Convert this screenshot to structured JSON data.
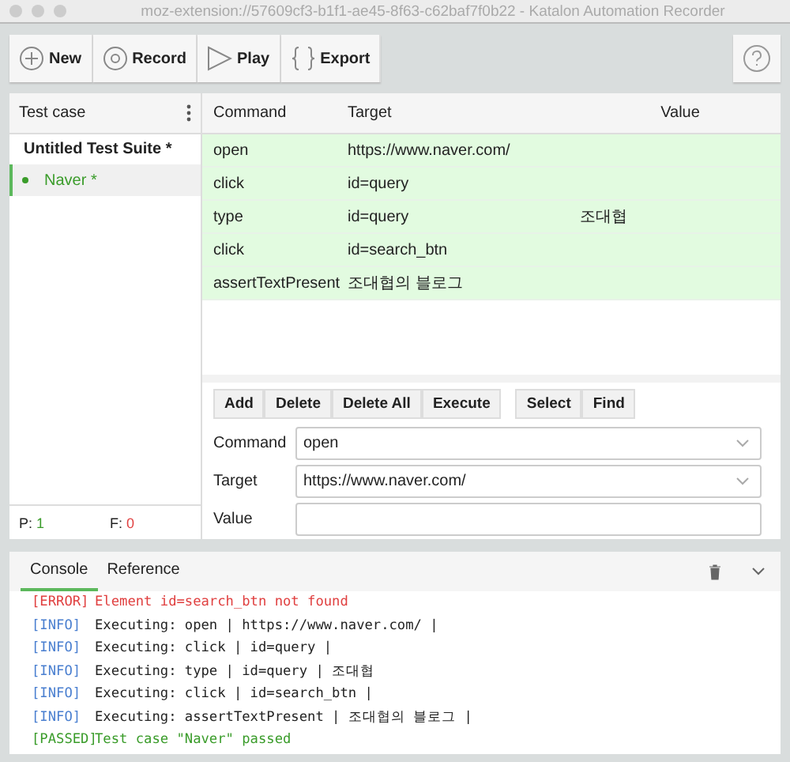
{
  "window": {
    "title": "moz-extension://57609cf3-b1f1-ae45-8f63-c62baf7f0b22 - Katalon Automation Recorder"
  },
  "toolbar": {
    "buttons": [
      {
        "kind": "new",
        "label": "New"
      },
      {
        "kind": "record",
        "label": "Record"
      },
      {
        "kind": "play",
        "label": "Play"
      },
      {
        "kind": "export",
        "label": "Export"
      }
    ]
  },
  "test_panel": {
    "header": "Test case",
    "suites": [
      {
        "name": "Untitled Test Suite *",
        "cases": [
          {
            "name": "Naver *",
            "selected": true,
            "passed": true
          }
        ]
      }
    ],
    "passed_label": "P:",
    "passed": "1",
    "failed_label": "F:",
    "failed": "0"
  },
  "table": {
    "columns": [
      "Command",
      "Target",
      "Value"
    ],
    "rows": [
      {
        "command": "open",
        "target": "https://www.naver.com/",
        "value": "",
        "passed": true
      },
      {
        "command": "click",
        "target": "id=query",
        "value": "",
        "passed": true
      },
      {
        "command": "type",
        "target": "id=query",
        "value": "조대협",
        "passed": true
      },
      {
        "command": "click",
        "target": "id=search_btn",
        "value": "",
        "passed": true
      },
      {
        "command": "assertTextPresent",
        "target": "조대협의 블로그",
        "value": "",
        "passed": true
      }
    ]
  },
  "edit_buttons": [
    [
      "Add",
      "Delete",
      "Delete All",
      "Execute"
    ],
    [
      "Select",
      "Find"
    ]
  ],
  "editor": {
    "command": {
      "label": "Command",
      "value": "open"
    },
    "target": {
      "label": "Target",
      "value": "https://www.naver.com/"
    },
    "value": {
      "label": "Value"
    }
  },
  "console": {
    "tabs": [
      {
        "label": "Console",
        "selected": true
      },
      {
        "label": "Reference",
        "selected": false
      }
    ],
    "lines": [
      {
        "kind": "error",
        "tag": "[ERROR]",
        "text": "Element id=search_btn not found"
      },
      {
        "kind": "info",
        "tag": "[INFO]",
        "text": "Executing: open | https://www.naver.com/ |"
      },
      {
        "kind": "info",
        "tag": "[INFO]",
        "text": "Executing: click | id=query |"
      },
      {
        "kind": "info",
        "tag": "[INFO]",
        "text": "Executing: type | id=query | 조대협"
      },
      {
        "kind": "info",
        "tag": "[INFO]",
        "text": "Executing: click | id=search_btn |"
      },
      {
        "kind": "info",
        "tag": "[INFO]",
        "text": "Executing: assertTextPresent | 조대협의 블로그 |"
      },
      {
        "kind": "passed",
        "tag": "[PASSED]",
        "text": "Test case \"Naver\" passed"
      }
    ]
  }
}
